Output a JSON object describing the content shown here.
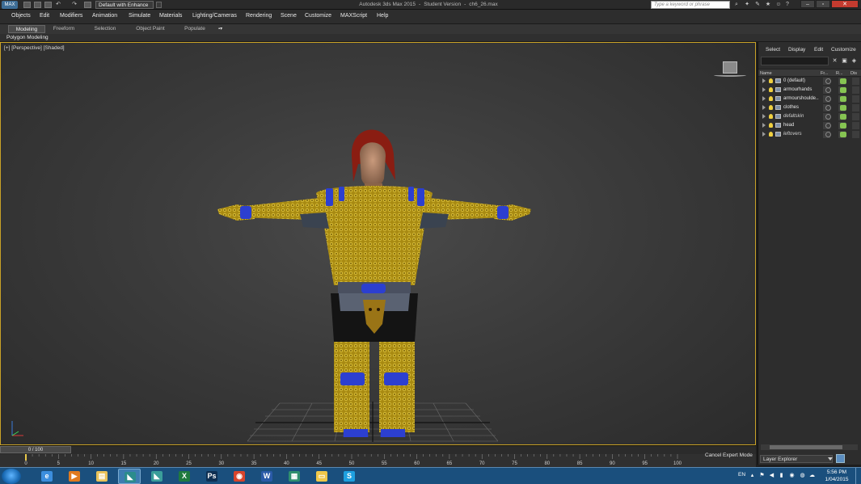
{
  "title_bar": {
    "logo": "MAX",
    "workspace": "Default with Enhance",
    "app_title": "Autodesk 3ds Max 2015",
    "version_label": "Student Version",
    "file_name": "ch6_26.max",
    "search_placeholder": "Type a keyword or phrase",
    "icons": [
      "new-file-icon",
      "open-file-icon",
      "save-icon",
      "undo-icon",
      "redo-icon",
      "binoculars-icon",
      "favorites-icon",
      "comm-center-icon",
      "user-icon",
      "help-icon"
    ]
  },
  "menu": [
    "Objects",
    "Edit",
    "Modifiers",
    "Animation",
    "Simulate",
    "Materials",
    "Lighting/Cameras",
    "Rendering",
    "Scene",
    "Customize",
    "MAXScript",
    "Help"
  ],
  "ribbon": {
    "tabs": [
      "Modeling",
      "Freeform",
      "Selection",
      "Object Paint",
      "Populate"
    ],
    "toggle": "▪▾",
    "panel_label": "Polygon Modeling"
  },
  "viewport": {
    "label": "[+] [Perspective] [Shaded]"
  },
  "scene_explorer": {
    "menus": [
      "Select",
      "Display",
      "Edit",
      "Customize"
    ],
    "columns": [
      "Name",
      "Fr...",
      "R...",
      "Dis"
    ],
    "layers": [
      {
        "name": "0 (default)",
        "italic": false
      },
      {
        "name": "armourhands",
        "italic": false
      },
      {
        "name": "armourshoulde...",
        "italic": false
      },
      {
        "name": "clothes",
        "italic": false
      },
      {
        "name": "defaltskin",
        "italic": true
      },
      {
        "name": "head",
        "italic": false
      },
      {
        "name": "leftovers",
        "italic": true
      }
    ],
    "dropdown": "Layer Explorer"
  },
  "timeline": {
    "frame_display": "0 / 100",
    "ticks": [
      "0",
      "5",
      "10",
      "15",
      "20",
      "25",
      "30",
      "35",
      "40",
      "45",
      "50",
      "55",
      "60",
      "65",
      "70",
      "75",
      "80",
      "85",
      "90",
      "95",
      "100"
    ],
    "expert_mode": "Cancel Expert Mode"
  },
  "taskbar": {
    "apps": [
      {
        "name": "ie",
        "glyph": "e",
        "color": "#3c8ede"
      },
      {
        "name": "media-player",
        "glyph": "▶",
        "color": "#e07a1f"
      },
      {
        "name": "explorer",
        "glyph": "▤",
        "color": "#e8c25a"
      },
      {
        "name": "3dsmax",
        "glyph": "◣",
        "color": "#2b8c8c"
      },
      {
        "name": "3dsmax-2",
        "glyph": "◣",
        "color": "#3b9e9a"
      },
      {
        "name": "excel",
        "glyph": "X",
        "color": "#1f7a3e"
      },
      {
        "name": "photoshop",
        "glyph": "Ps",
        "color": "#0e2f52"
      },
      {
        "name": "chrome",
        "glyph": "◉",
        "color": "#d8442c"
      },
      {
        "name": "word",
        "glyph": "W",
        "color": "#2a5aa8"
      },
      {
        "name": "autodesk",
        "glyph": "▦",
        "color": "#2f8f6e"
      },
      {
        "name": "folder",
        "glyph": "▭",
        "color": "#f0c84a"
      },
      {
        "name": "skype",
        "glyph": "S",
        "color": "#1ea0e0"
      }
    ],
    "language": "EN",
    "time": "5:56 PM",
    "date": "1/04/2015"
  },
  "colors": {
    "viewport_border": "#c9a227",
    "armor_gold": "#b99a18",
    "armor_blue": "#2c3fd0",
    "taskbar": "#1a4f7d"
  }
}
